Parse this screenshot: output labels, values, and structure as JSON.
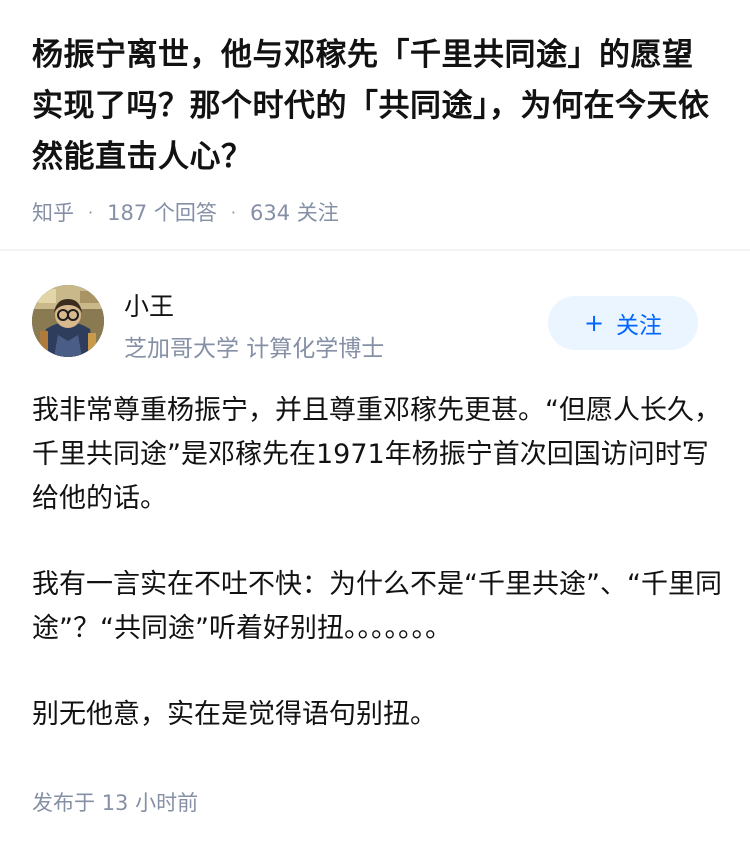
{
  "question": {
    "title": "杨振宁离世，他与邓稼先「千里共同途」的愿望实现了吗？那个时代的「共同途」，为何在今天依然能直击人心？",
    "source": "知乎",
    "separator": "·",
    "answers_count": "187",
    "answers_label": "个回答",
    "followers_count": "634",
    "followers_label": "关注"
  },
  "author": {
    "name": "小王",
    "bio": "芝加哥大学 计算化学博士",
    "follow_plus": "+",
    "follow_label": "关注",
    "avatar_icon": "user-avatar-photo"
  },
  "answer": {
    "paragraphs": [
      "我非常尊重杨振宁，并且尊重邓稼先更甚。“但愿人长久，千里共同途”是邓稼先在1971年杨振宁首次回国访问时写给他的话。",
      "我有一言实在不吐不快：为什么不是“千里共途”、“千里同途”？“共同途”听着好别扭。。。。。。。",
      "别无他意，实在是觉得语句别扭。"
    ]
  },
  "footer": {
    "posted_label": "发布于",
    "posted_time": "13 小时前"
  },
  "colors": {
    "text": "#121212",
    "meta": "#8590a6",
    "accent": "#0066ff",
    "follow_bg": "#ebf5ff"
  }
}
